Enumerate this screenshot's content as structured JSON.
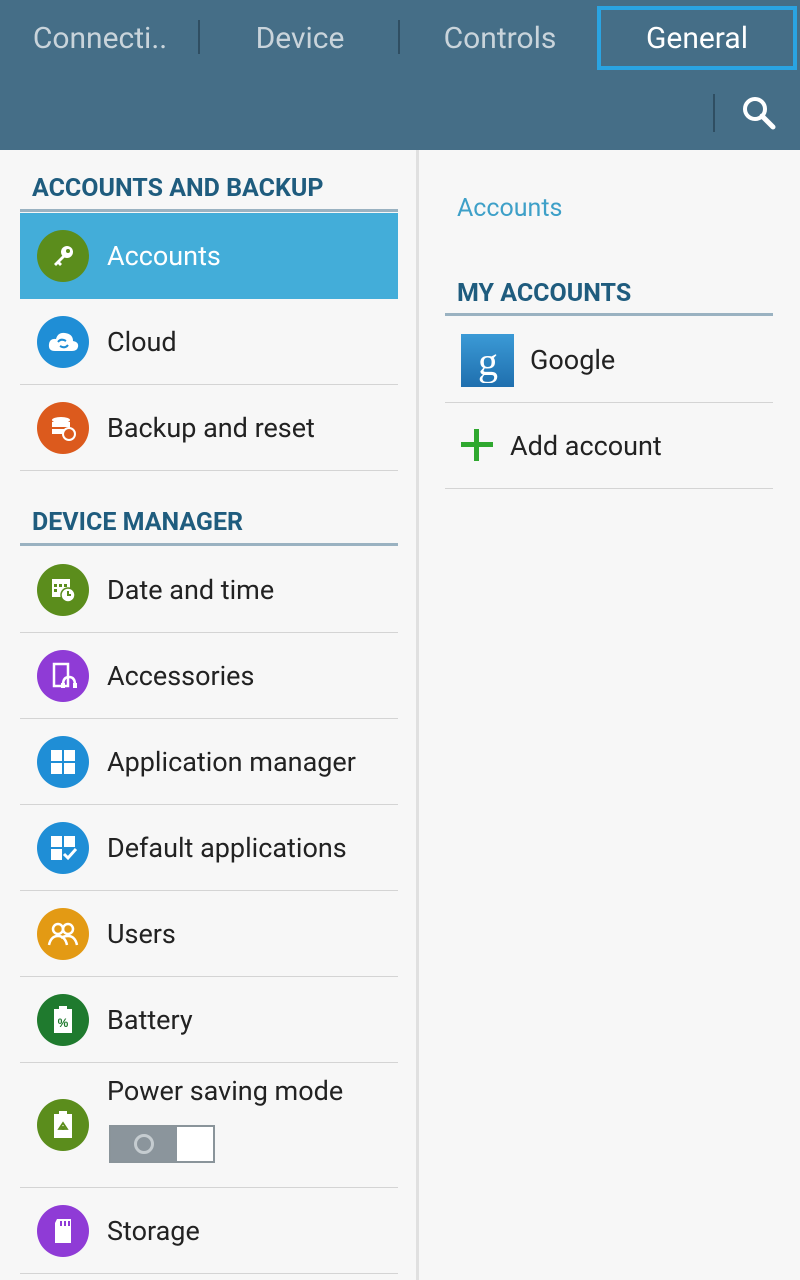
{
  "tabs": [
    {
      "label": "Connecti.."
    },
    {
      "label": "Device"
    },
    {
      "label": "Controls"
    },
    {
      "label": "General",
      "selected": true
    }
  ],
  "search_icon": "search-icon",
  "sections": [
    {
      "title": "ACCOUNTS AND BACKUP",
      "items": [
        {
          "label": "Accounts",
          "icon": "key-icon",
          "color": "#5b8d1c",
          "selected": true
        },
        {
          "label": "Cloud",
          "icon": "cloud-sync-icon",
          "color": "#1f8ed6"
        },
        {
          "label": "Backup and reset",
          "icon": "backup-database-icon",
          "color": "#dc5a1d"
        }
      ]
    },
    {
      "title": "DEVICE MANAGER",
      "items": [
        {
          "label": "Date and time",
          "icon": "calendar-clock-icon",
          "color": "#5b8d1c"
        },
        {
          "label": "Accessories",
          "icon": "accessories-headset-icon",
          "color": "#8f3bd6"
        },
        {
          "label": "Application manager",
          "icon": "grid-apps-icon",
          "color": "#1f8ed6"
        },
        {
          "label": "Default applications",
          "icon": "grid-check-icon",
          "color": "#1f8ed6"
        },
        {
          "label": "Users",
          "icon": "users-icon",
          "color": "#e39a14"
        },
        {
          "label": "Battery",
          "icon": "battery-percent-icon",
          "color": "#1f7a2e"
        },
        {
          "label": "Power saving mode",
          "icon": "power-saving-battery-icon",
          "color": "#5b8d1c",
          "toggle": "off"
        },
        {
          "label": "Storage",
          "icon": "sd-card-icon",
          "color": "#8f3bd6"
        }
      ]
    }
  ],
  "right_panel": {
    "breadcrumb": "Accounts",
    "section_title": "MY ACCOUNTS",
    "accounts": [
      {
        "label": "Google",
        "icon": "google-icon"
      }
    ],
    "add_account_label": "Add account",
    "add_icon": "plus-icon",
    "add_icon_color": "#2fa82f"
  }
}
